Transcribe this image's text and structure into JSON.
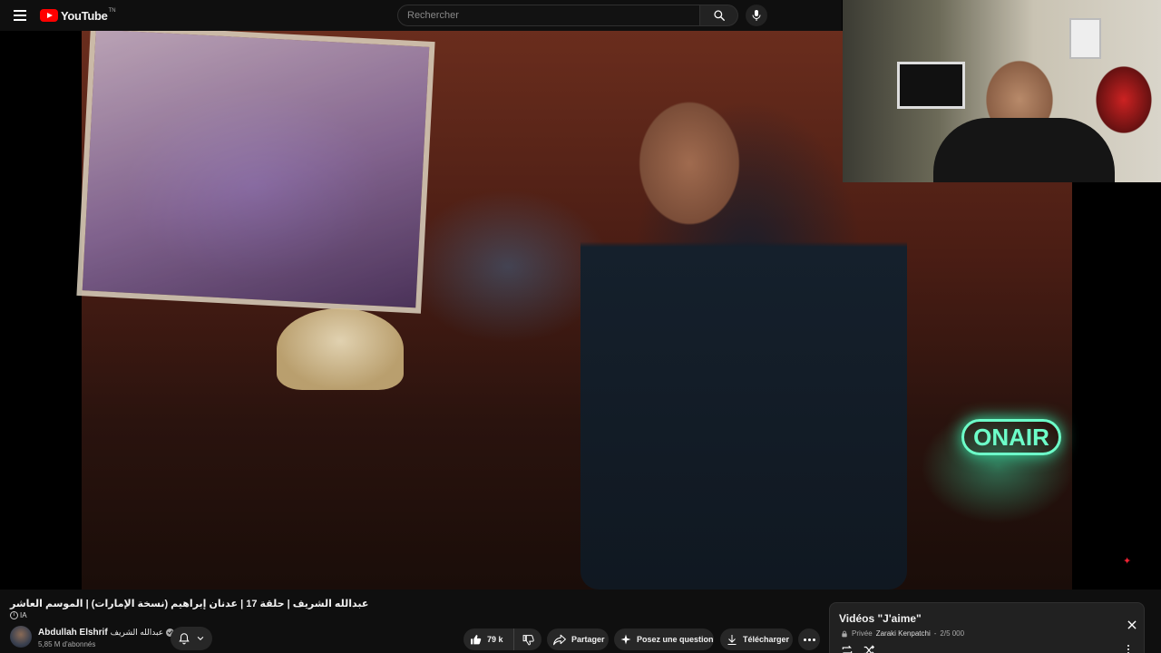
{
  "header": {
    "logo_text": "YouTube",
    "logo_region": "TN",
    "search_placeholder": "Rechercher"
  },
  "video": {
    "title": "عبدالله الشريف | حلقة 17 | عدنان إبراهيم (نسخة الإمارات) | الموسم العاشر",
    "ai_badge": "IA",
    "neon_sign": "ONAIR"
  },
  "channel": {
    "name": "Abdullah Elshrif",
    "name_arabic": "عبدالله الشريف",
    "subscribers": "5,85 M d'abonnés"
  },
  "actions": {
    "likes": "79 k",
    "share": "Partager",
    "ask": "Posez une question",
    "download": "Télécharger"
  },
  "playlist": {
    "title": "Vidéos \"J'aime\"",
    "privacy": "Privée",
    "owner": "Zaraki Kenpatchi",
    "position": "2/5 000"
  },
  "colors": {
    "accent": "#ff0000",
    "background": "#0f0f0f",
    "pill": "#272727"
  }
}
